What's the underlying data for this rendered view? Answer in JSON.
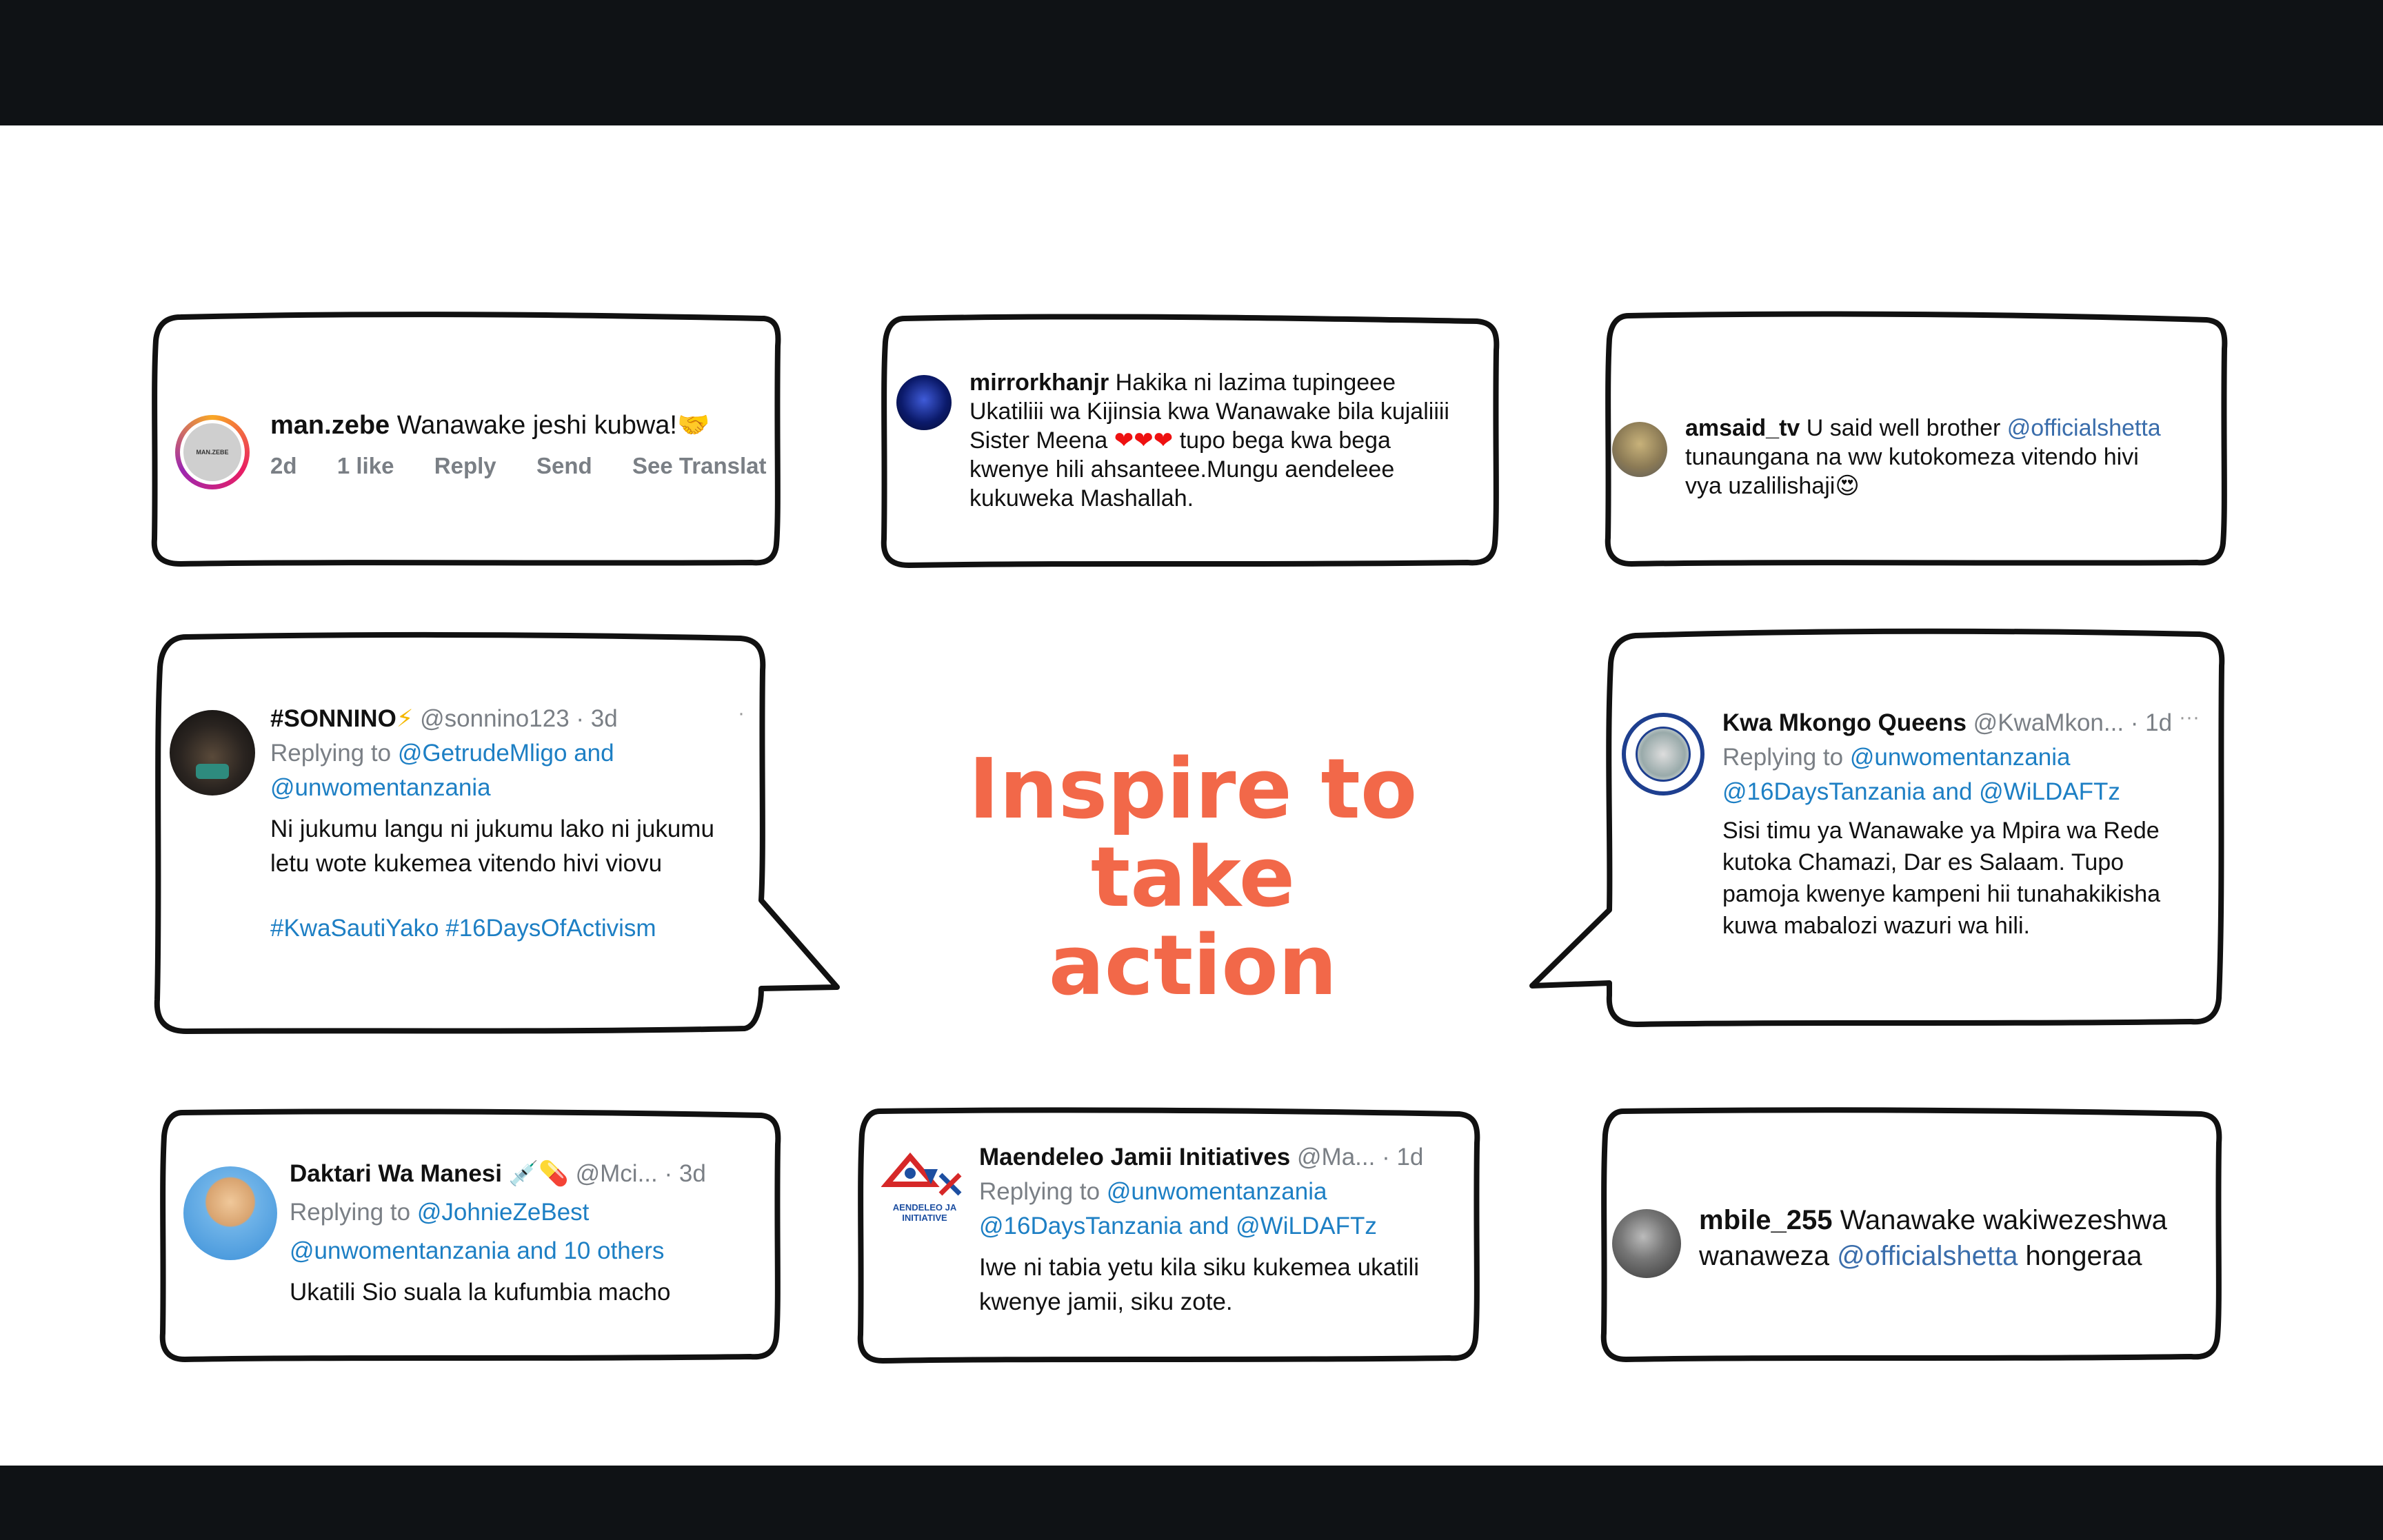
{
  "headline": [
    "Inspire to",
    "take",
    "action"
  ],
  "cards": {
    "manzebe": {
      "username": "man.zebe",
      "comment": "Wanawake jeshi kubwa!",
      "emoji": "🤝",
      "avatar_text": "MAN.ZEBE",
      "meta": [
        "2d",
        "1 like",
        "Reply",
        "Send",
        "See Translat"
      ]
    },
    "mirror": {
      "username": "mirrorkhanjr",
      "comment_1": "Hakika ni lazima tupingeee",
      "comment_2": "Ukatiliii wa Kijinsia kwa Wanawake bila kujaliiii",
      "comment_3a": "Sister Meena",
      "hearts": "❤❤❤",
      "comment_3b": "tupo bega kwa bega",
      "comment_4": "kwenye hili ahsanteee.Mungu aendeleee",
      "comment_5": "kukuweka Mashallah."
    },
    "amsaid": {
      "username": "amsaid_tv",
      "comment_1": "U said well brother",
      "mention": "@officialshetta",
      "comment_2": "tunaungana na ww kutokomeza vitendo hivi",
      "comment_3": "vya uzalilishaji",
      "emoji": "😍"
    },
    "sonnino": {
      "name": "#SONNINO",
      "badge": "⚡",
      "handle": "@sonnino123 · 3d",
      "replying_label": "Replying to",
      "replying_1": "@GetrudeMligo and",
      "replying_2": "@unwomentanzania",
      "body_1": "Ni jukumu langu ni jukumu lako ni jukumu",
      "body_2": "letu wote kukemea vitendo hivi viovu",
      "hashtags": "#KwaSautiYako #16DaysOfActivism",
      "menu": "·"
    },
    "kwamkongo": {
      "name": "Kwa Mkongo Queens",
      "handle": "@KwaMkon... · 1d",
      "replying_label": "Replying to",
      "replying_1": "@unwomentanzania",
      "replying_2": "@16DaysTanzania and @WiLDAFTz",
      "body_1": "Sisi timu ya Wanawake ya Mpira wa Rede",
      "body_2": "kutoka Chamazi, Dar es Salaam. Tupo",
      "body_3": "pamoja kwenye kampeni hii tunahakikisha",
      "body_4": "kuwa mabalozi wazuri wa hili.",
      "menu": "···"
    },
    "daktari": {
      "name": "Daktari Wa Manesi",
      "badges": "💉💊",
      "handle": "@Mci... · 3d",
      "replying_label": "Replying to",
      "replying_1": "@JohnieZeBest",
      "replying_2": "@unwomentanzania and 10 others",
      "body": "Ukatili Sio suala la kufumbia macho"
    },
    "maendeleo": {
      "name": "Maendeleo Jamii Initiatives",
      "handle": "@Ma... · 1d",
      "replying_label": "Replying to",
      "replying_1": "@unwomentanzania",
      "replying_2": "@16DaysTanzania and @WiLDAFTz",
      "body_1": "Iwe ni tabia yetu kila siku kukemea ukatili",
      "body_2": "kwenye jamii, siku zote.",
      "logo_text_1": "AENDELEO JA",
      "logo_text_2": "INITIATIVE"
    },
    "mbile": {
      "username": "mbile_255",
      "comment_1": "Wanawake wakiwezeshwa",
      "comment_2a": "wanaweza",
      "mention": "@officialshetta",
      "comment_2b": "hongeraa"
    }
  },
  "colors": {
    "headline": "#f26849",
    "link": "#1d7fc4",
    "ig_link": "#3a6dab",
    "muted": "#7a7f85",
    "bar": "#0f1215"
  }
}
